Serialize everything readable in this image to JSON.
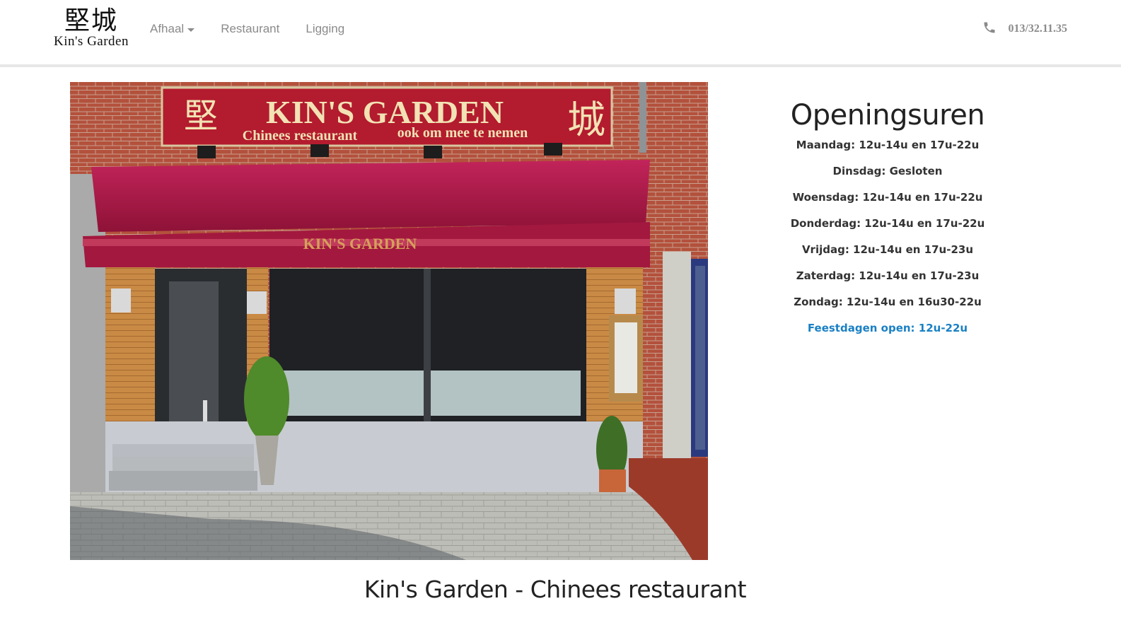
{
  "brand": {
    "cn": "堅城",
    "en": "Kin's Garden"
  },
  "nav": {
    "items": [
      {
        "label": "Afhaal",
        "dropdown": true
      },
      {
        "label": "Restaurant"
      },
      {
        "label": "Ligging"
      }
    ]
  },
  "contact": {
    "icon": "phone-icon",
    "phone": "013/32.11.35"
  },
  "photo": {
    "sign_title": "KIN'S GARDEN",
    "sign_subtitle_left": "Chinees restaurant",
    "sign_subtitle_right": "ook om mee te nemen",
    "sign_cn_left": "堅",
    "sign_cn_right": "城",
    "awning_text": "KIN'S GARDEN"
  },
  "hours": {
    "title": "Openingsuren",
    "rows": [
      "Maandag: 12u-14u en 17u-22u",
      "Dinsdag: Gesloten",
      "Woensdag: 12u-14u en 17u-22u",
      "Donderdag: 12u-14u en 17u-22u",
      "Vrijdag: 12u-14u en 17u-23u",
      "Zaterdag: 12u-14u en 17u-23u",
      "Zondag: 12u-14u en 16u30-22u"
    ],
    "holiday": "Feestdagen open: 12u-22u"
  },
  "caption": "Kin's Garden - Chinees restaurant",
  "colors": {
    "accent": "#1a80c4",
    "nav_text": "#8a8a8a",
    "awning": "#a0163a",
    "sign": "#b31b2e"
  }
}
